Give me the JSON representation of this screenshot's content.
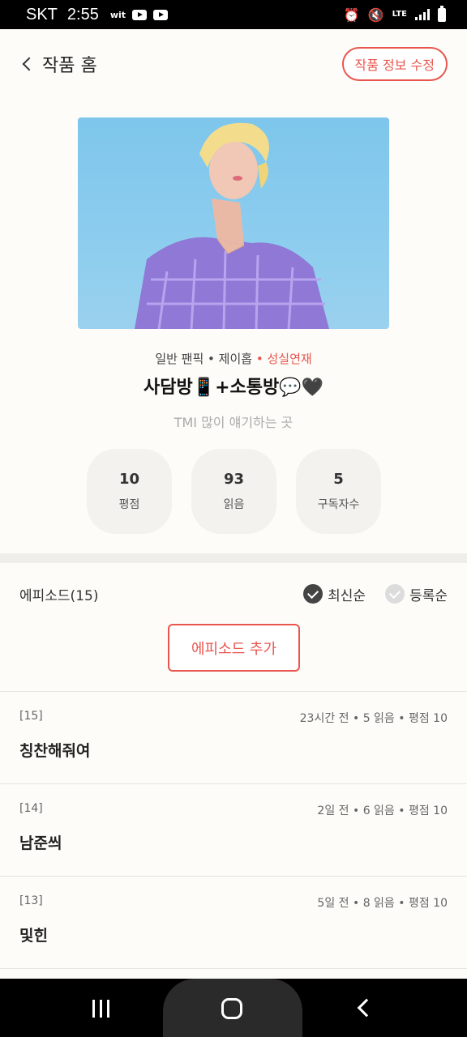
{
  "status_bar": {
    "carrier": "SKT",
    "time": "2:55",
    "wit_label": "wit",
    "lte_label": "LTE"
  },
  "header": {
    "back_label": "작품 홈",
    "edit_button": "작품 정보 수정"
  },
  "work": {
    "genre": "일반 팬픽",
    "author": "제이홉",
    "badge": "성실연재",
    "separator": " • ",
    "title": "사담방📱+소통방💬🖤",
    "subtitle": "TMI 많이 얘기하는 곳"
  },
  "stats": [
    {
      "value": "10",
      "label": "평점"
    },
    {
      "value": "93",
      "label": "읽음"
    },
    {
      "value": "5",
      "label": "구독자수"
    }
  ],
  "episodes_header": {
    "count_label": "에피소드(15)",
    "sort_latest": "최신순",
    "sort_registered": "등록순",
    "selected_sort": "최신순",
    "add_button": "에피소드 추가"
  },
  "episodes": [
    {
      "no": "[15]",
      "info": "23시간 전 • 5 읽음 • 평점 10",
      "title": "칭찬해줘여"
    },
    {
      "no": "[14]",
      "info": "2일 전 • 6 읽음 • 평점 10",
      "title": "남준씌"
    },
    {
      "no": "[13]",
      "info": "5일 전 • 8 읽음 • 평점 10",
      "title": "및힌"
    }
  ],
  "colors": {
    "accent": "#e8564f",
    "background": "#fdfcf8",
    "stat_bg": "#f3f2ee"
  }
}
